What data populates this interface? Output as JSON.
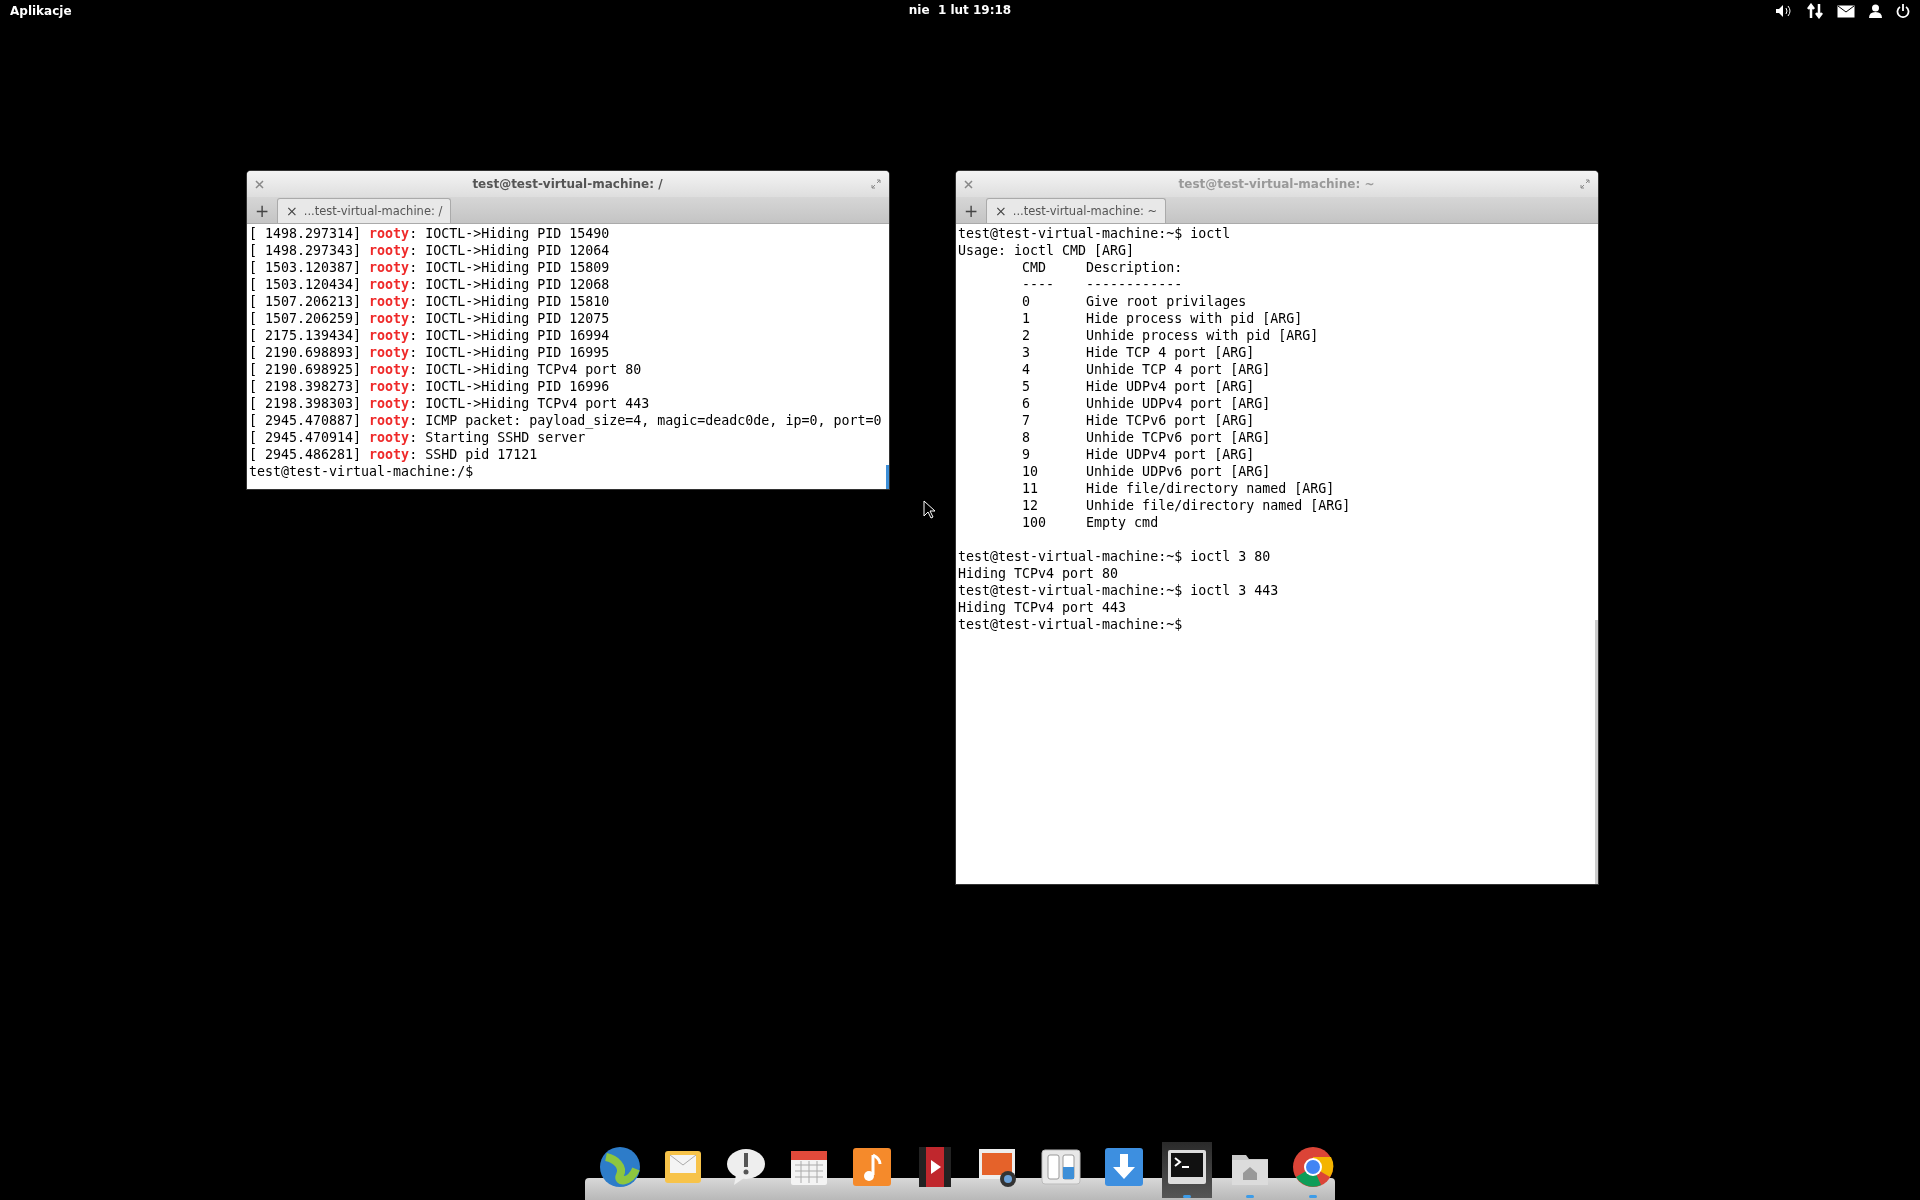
{
  "top_panel": {
    "menu": "Aplikacje",
    "clock": "nie  1 lut 19:18"
  },
  "windows": [
    {
      "title": "test@test-virtual-machine: /",
      "focused": true,
      "tab": "...test-virtual-machine: /",
      "tab_close": "×",
      "new_tab": "+",
      "lines": [
        {
          "kind": "log",
          "time": "[ 1498.297314]",
          "source": "rooty",
          "message": ": IOCTL->Hiding PID 15490"
        },
        {
          "kind": "log",
          "time": "[ 1498.297343]",
          "source": "rooty",
          "message": ": IOCTL->Hiding PID 12064"
        },
        {
          "kind": "log",
          "time": "[ 1503.120387]",
          "source": "rooty",
          "message": ": IOCTL->Hiding PID 15809"
        },
        {
          "kind": "log",
          "time": "[ 1503.120434]",
          "source": "rooty",
          "message": ": IOCTL->Hiding PID 12068"
        },
        {
          "kind": "log",
          "time": "[ 1507.206213]",
          "source": "rooty",
          "message": ": IOCTL->Hiding PID 15810"
        },
        {
          "kind": "log",
          "time": "[ 1507.206259]",
          "source": "rooty",
          "message": ": IOCTL->Hiding PID 12075"
        },
        {
          "kind": "log",
          "time": "[ 2175.139434]",
          "source": "rooty",
          "message": ": IOCTL->Hiding PID 16994"
        },
        {
          "kind": "log",
          "time": "[ 2190.698893]",
          "source": "rooty",
          "message": ": IOCTL->Hiding PID 16995"
        },
        {
          "kind": "log",
          "time": "[ 2190.698925]",
          "source": "rooty",
          "message": ": IOCTL->Hiding TCPv4 port 80"
        },
        {
          "kind": "log",
          "time": "[ 2198.398273]",
          "source": "rooty",
          "message": ": IOCTL->Hiding PID 16996"
        },
        {
          "kind": "log",
          "time": "[ 2198.398303]",
          "source": "rooty",
          "message": ": IOCTL->Hiding TCPv4 port 443"
        },
        {
          "kind": "log",
          "time": "[ 2945.470887]",
          "source": "rooty",
          "message": ": ICMP packet: payload_size=4, magic=deadc0de, ip=0, port=0"
        },
        {
          "kind": "log",
          "time": "[ 2945.470914]",
          "source": "rooty",
          "message": ": Starting SSHD server"
        },
        {
          "kind": "log",
          "time": "[ 2945.486281]",
          "source": "rooty",
          "message": ": SSHD pid 17121"
        },
        {
          "kind": "text",
          "text": "test@test-virtual-machine:/$"
        }
      ]
    },
    {
      "title": "test@test-virtual-machine: ~",
      "focused": false,
      "tab": "...test-virtual-machine: ~",
      "tab_close": "×",
      "new_tab": "+",
      "lines": [
        {
          "kind": "text",
          "text": "test@test-virtual-machine:~$ ioctl"
        },
        {
          "kind": "text",
          "text": "Usage: ioctl CMD [ARG]"
        },
        {
          "kind": "text",
          "text": "        CMD     Description:"
        },
        {
          "kind": "text",
          "text": "        ----    ------------"
        },
        {
          "kind": "text",
          "text": "        0       Give root privilages"
        },
        {
          "kind": "text",
          "text": "        1       Hide process with pid [ARG]"
        },
        {
          "kind": "text",
          "text": "        2       Unhide process with pid [ARG]"
        },
        {
          "kind": "text",
          "text": "        3       Hide TCP 4 port [ARG]"
        },
        {
          "kind": "text",
          "text": "        4       Unhide TCP 4 port [ARG]"
        },
        {
          "kind": "text",
          "text": "        5       Hide UDPv4 port [ARG]"
        },
        {
          "kind": "text",
          "text": "        6       Unhide UDPv4 port [ARG]"
        },
        {
          "kind": "text",
          "text": "        7       Hide TCPv6 port [ARG]"
        },
        {
          "kind": "text",
          "text": "        8       Unhide TCPv6 port [ARG]"
        },
        {
          "kind": "text",
          "text": "        9       Hide UDPv4 port [ARG]"
        },
        {
          "kind": "text",
          "text": "        10      Unhide UDPv6 port [ARG]"
        },
        {
          "kind": "text",
          "text": "        11      Hide file/directory named [ARG]"
        },
        {
          "kind": "text",
          "text": "        12      Unhide file/directory named [ARG]"
        },
        {
          "kind": "text",
          "text": "        100     Empty cmd"
        },
        {
          "kind": "blank"
        },
        {
          "kind": "text",
          "text": "test@test-virtual-machine:~$ ioctl 3 80"
        },
        {
          "kind": "text",
          "text": "Hiding TCPv4 port 80"
        },
        {
          "kind": "text",
          "text": "test@test-virtual-machine:~$ ioctl 3 443"
        },
        {
          "kind": "text",
          "text": "Hiding TCPv4 port 443"
        },
        {
          "kind": "text",
          "text": "test@test-virtual-machine:~$"
        }
      ]
    }
  ],
  "dock": {
    "items": [
      {
        "running": false,
        "active": false
      },
      {
        "running": false,
        "active": false
      },
      {
        "running": false,
        "active": false
      },
      {
        "running": false,
        "active": false
      },
      {
        "running": false,
        "active": false
      },
      {
        "running": false,
        "active": false
      },
      {
        "running": false,
        "active": false
      },
      {
        "running": false,
        "active": false
      },
      {
        "running": false,
        "active": false
      },
      {
        "running": true,
        "active": true
      },
      {
        "running": true,
        "active": false
      },
      {
        "running": true,
        "active": false
      }
    ]
  }
}
